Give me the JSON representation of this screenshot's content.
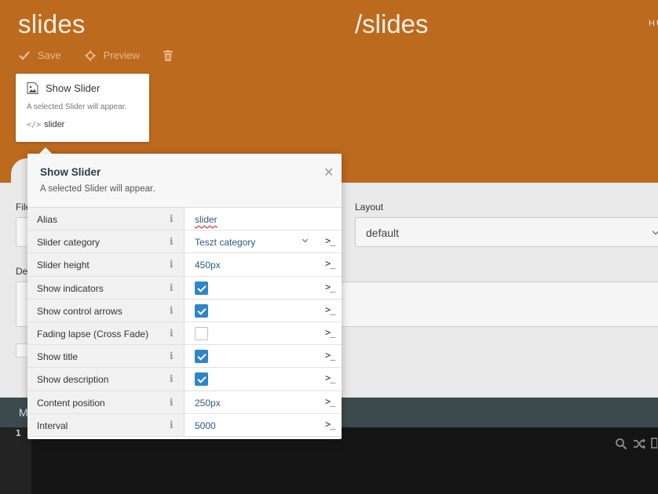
{
  "header": {
    "title": "slides",
    "path": "/slides",
    "hint": "HU",
    "toolbar": {
      "save_label": "Save",
      "preview_label": "Preview"
    }
  },
  "card": {
    "title": "Show Slider",
    "description": "A selected Slider will appear.",
    "code": "slider"
  },
  "form": {
    "label_file": "File",
    "label_description": "De",
    "label_layout": "Layout",
    "layout_value": "default"
  },
  "bottom": {
    "bar_label": "M",
    "line_number": "1"
  },
  "popover": {
    "title": "Show Slider",
    "description": "A selected Slider will appear.",
    "terminal_glyph": ">_",
    "rows": [
      {
        "label": "Alias",
        "value": "slider"
      },
      {
        "label": "Slider category",
        "value": "Teszt category"
      },
      {
        "label": "Slider height",
        "value": "450px"
      },
      {
        "label": "Show indicators",
        "checked": true
      },
      {
        "label": "Show control arrows",
        "checked": true
      },
      {
        "label": "Fading lapse (Cross Fade)",
        "checked": false
      },
      {
        "label": "Show title",
        "checked": true
      },
      {
        "label": "Show description",
        "checked": true
      },
      {
        "label": "Content position",
        "value": "250px"
      },
      {
        "label": "Interval",
        "value": "5000"
      }
    ]
  },
  "colors": {
    "header": "#bb6a1e",
    "checkbox": "#2e86c9",
    "dark_bar": "#3c4a4e"
  }
}
